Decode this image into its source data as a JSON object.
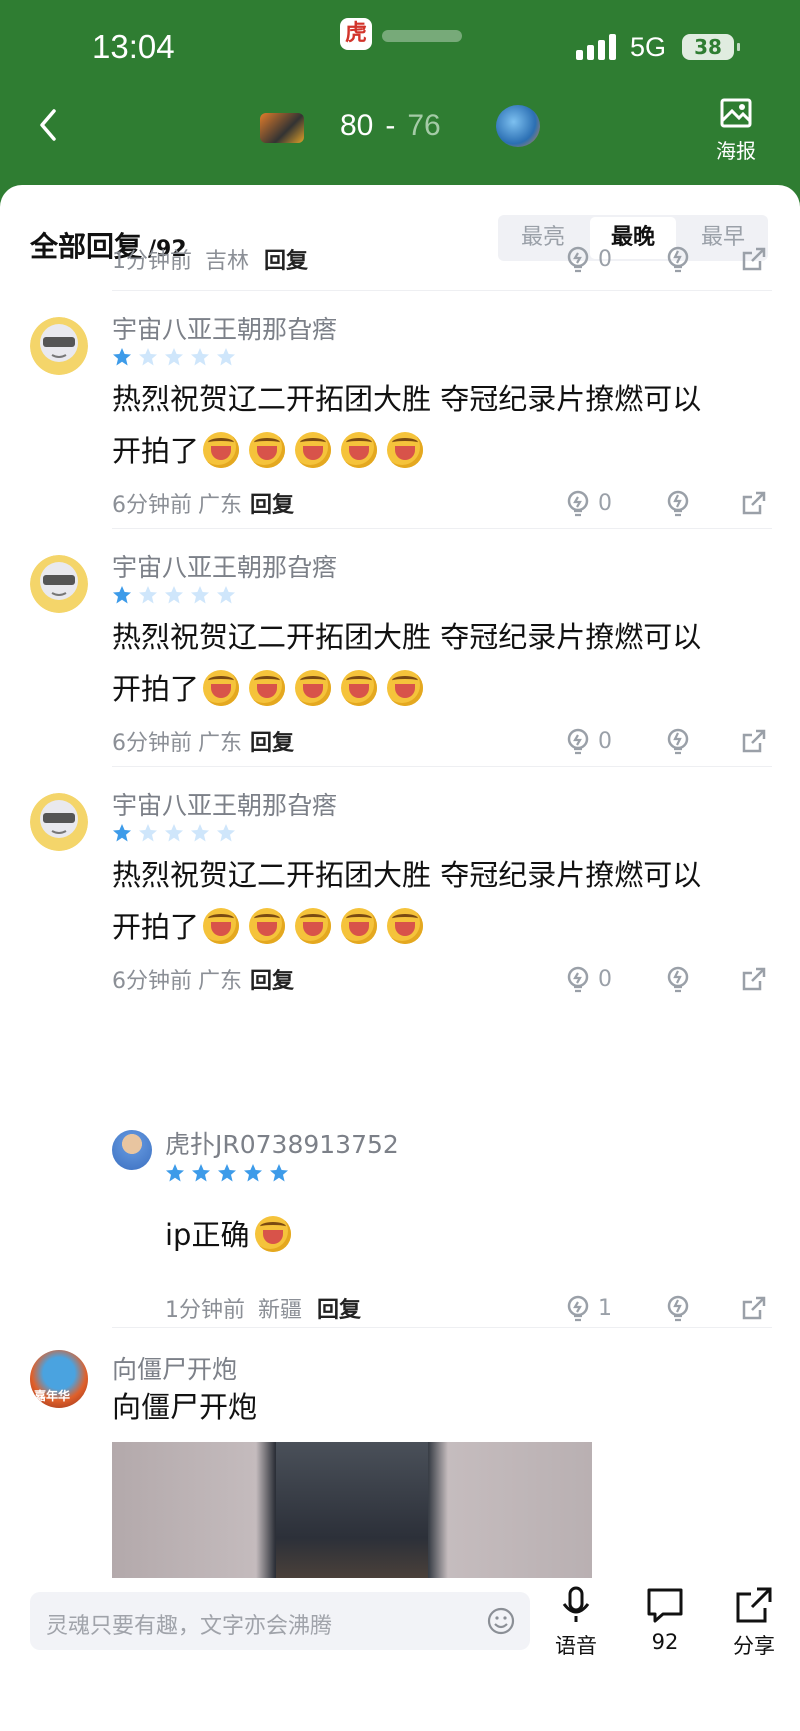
{
  "status_bar": {
    "time": "13:04",
    "network": "5G",
    "battery": "38",
    "app_badge": "虎"
  },
  "header": {
    "home_score": "80",
    "separator": "-",
    "away_score": "76",
    "poster_label": "海报"
  },
  "comments_header": {
    "title": "全部回复",
    "count": "/92",
    "sort_options": [
      "最亮",
      "最晚",
      "最早"
    ],
    "active_sort": "最晚"
  },
  "top_partial_meta": {
    "time": "1分钟前",
    "location": "吉林",
    "reply": "回复",
    "likes": "0"
  },
  "comments": [
    {
      "username": "宇宙八亚王朝那旮瘩",
      "rating": 1,
      "text_line1": "热烈祝贺辽二开拓团大胜 夺冠纪录片撩燃可以",
      "text_line2": "开拍了",
      "emoji_count": 5,
      "time": "6分钟前",
      "location": "广东",
      "reply": "回复",
      "likes": "0"
    },
    {
      "username": "宇宙八亚王朝那旮瘩",
      "rating": 1,
      "text_line1": "热烈祝贺辽二开拓团大胜 夺冠纪录片撩燃可以",
      "text_line2": "开拍了",
      "emoji_count": 5,
      "time": "6分钟前",
      "location": "广东",
      "reply": "回复",
      "likes": "0"
    },
    {
      "username": "宇宙八亚王朝那旮瘩",
      "rating": 1,
      "text_line1": "热烈祝贺辽二开拓团大胜 夺冠纪录片撩燃可以",
      "text_line2": "开拍了",
      "emoji_count": 5,
      "time": "6分钟前",
      "location": "广东",
      "reply": "回复",
      "likes": "0"
    }
  ],
  "sub_reply": {
    "username": "虎扑JR0738913752",
    "rating": 5,
    "text": "ip正确",
    "time": "1分钟前",
    "location": "新疆",
    "reply": "回复",
    "likes": "1"
  },
  "last_comment": {
    "username": "向僵尸开炮",
    "text": "向僵尸开炮",
    "avatar_badge": "嘉年华"
  },
  "bottom_bar": {
    "input_placeholder": "灵魂只要有趣，文字亦会沸腾",
    "voice_label": "语音",
    "comment_count": "92",
    "share_label": "分享"
  },
  "colors": {
    "header_green": "#2f7d32",
    "star_blue": "#3d9be9",
    "star_empty": "#cfe6fb"
  }
}
